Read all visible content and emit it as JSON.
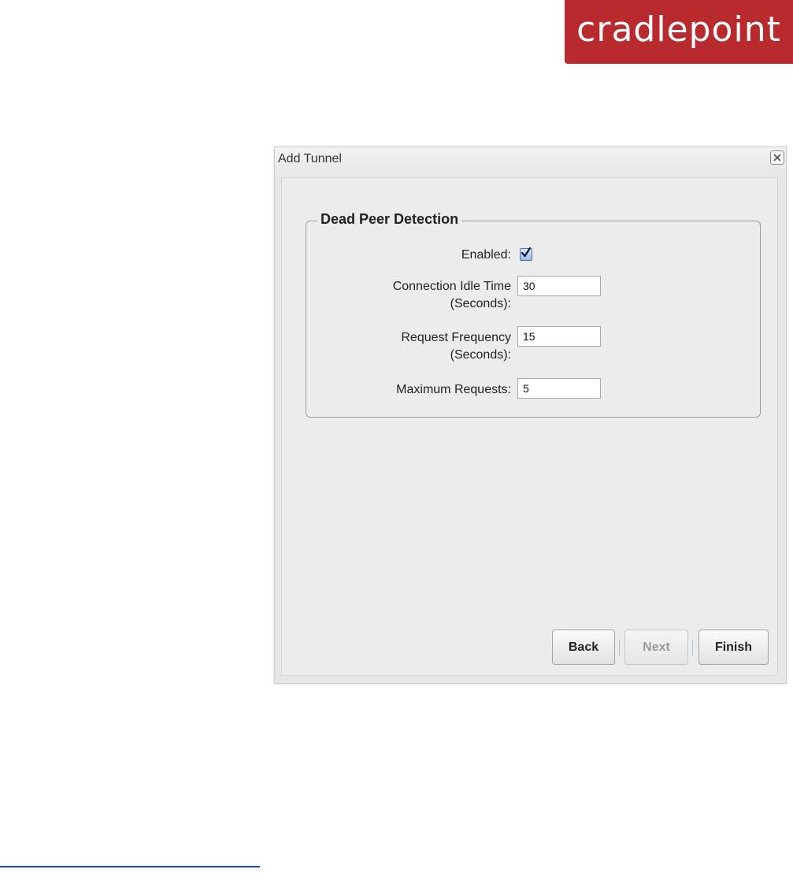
{
  "brand": {
    "logo_text": "cradlepoint",
    "color": "#b82a2d"
  },
  "dialog": {
    "title": "Add Tunnel",
    "close_icon": "close-icon",
    "section": {
      "legend": "Dead Peer Detection",
      "enabled": {
        "label": "Enabled:",
        "checked": true
      },
      "idle_time": {
        "label_line1": "Connection Idle Time",
        "label_line2": "(Seconds):",
        "value": "30"
      },
      "request_frequency": {
        "label_line1": "Request Frequency",
        "label_line2": "(Seconds):",
        "value": "15"
      },
      "max_requests": {
        "label": "Maximum Requests:",
        "value": "5"
      }
    },
    "buttons": {
      "back": "Back",
      "next": "Next",
      "finish": "Finish"
    }
  }
}
